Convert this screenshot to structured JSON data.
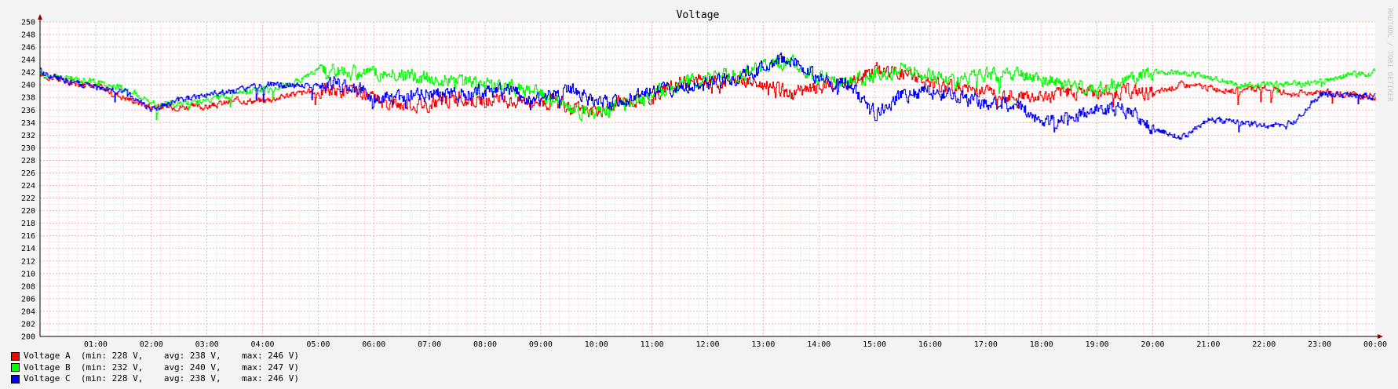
{
  "colors": {
    "background": "#f3f3f3",
    "plot_background": "#ffffff",
    "grid_minor": "#f1c6c6",
    "grid_major": "#e8a7a7",
    "axis": "#880000"
  },
  "side_label": "RRDTOOL / TOBI OETIKER",
  "legend": [
    {
      "name": "Voltage A",
      "color": "#ff0000",
      "stats": "  (min: 228 V,    avg: 238 V,    max: 246 V)"
    },
    {
      "name": "Voltage B",
      "color": "#00ff00",
      "stats": "  (min: 232 V,    avg: 240 V,    max: 247 V)"
    },
    {
      "name": "Voltage C",
      "color": "#0000ff",
      "stats": "  (min: 228 V,    avg: 238 V,    max: 246 V)"
    }
  ],
  "chart_data": {
    "type": "line",
    "title": "Voltage",
    "xlabel": "",
    "ylabel": "",
    "ylim": [
      200,
      250
    ],
    "y_ticks": [
      200,
      202,
      204,
      206,
      208,
      210,
      212,
      214,
      216,
      218,
      220,
      222,
      224,
      226,
      228,
      230,
      232,
      234,
      236,
      238,
      240,
      242,
      244,
      246,
      248,
      250
    ],
    "x_ticks": [
      "01:00",
      "02:00",
      "03:00",
      "04:00",
      "05:00",
      "06:00",
      "07:00",
      "08:00",
      "09:00",
      "10:00",
      "11:00",
      "12:00",
      "13:00",
      "14:00",
      "15:00",
      "16:00",
      "17:00",
      "18:00",
      "19:00",
      "20:00",
      "21:00",
      "22:00",
      "23:00",
      "00:00"
    ],
    "x_hours": [
      0,
      0.5,
      1,
      1.5,
      2,
      2.5,
      3,
      3.5,
      4,
      4.5,
      5,
      5.5,
      6,
      6.5,
      7,
      7.5,
      8,
      8.5,
      9,
      9.5,
      10,
      10.5,
      11,
      11.5,
      12,
      12.5,
      13,
      13.5,
      14,
      14.5,
      15,
      15.5,
      16,
      16.5,
      17,
      17.5,
      18,
      18.5,
      19,
      19.5,
      20,
      20.5,
      21,
      21.5,
      22,
      22.5,
      23,
      23.5,
      24
    ],
    "grid": true,
    "series": [
      {
        "name": "Voltage A",
        "color": "#ff0000",
        "values": [
          241.5,
          240.5,
          239.8,
          238,
          236.5,
          236.5,
          236.5,
          237.5,
          237.5,
          238.5,
          239,
          239,
          237.5,
          237,
          237,
          238,
          237.5,
          237.5,
          237.5,
          236.5,
          235.5,
          237.5,
          238,
          240.5,
          240.5,
          241,
          240,
          238.5,
          239.5,
          240,
          242.5,
          242,
          240,
          239.5,
          239,
          238.5,
          238,
          239,
          239,
          239,
          238.5,
          240,
          239.5,
          239,
          239.5,
          238.5,
          239,
          238.5,
          238
        ]
      },
      {
        "name": "Voltage B",
        "color": "#00ff00",
        "values": [
          241.5,
          241,
          240.5,
          239.5,
          237,
          237,
          237.5,
          238.5,
          239.5,
          240,
          242.5,
          242,
          242,
          241.5,
          241,
          240.5,
          240,
          239.5,
          238.5,
          236,
          235.5,
          237,
          238.5,
          240,
          241.5,
          241.5,
          243,
          243.5,
          241,
          240.5,
          241.5,
          242.5,
          241.5,
          240.5,
          241.5,
          241.5,
          241,
          240,
          239.5,
          240.5,
          242,
          242,
          241,
          240,
          240,
          240,
          240.5,
          241.5,
          242
        ]
      },
      {
        "name": "Voltage C",
        "color": "#0000ff",
        "values": [
          242,
          240.5,
          239.5,
          239,
          236,
          237.5,
          238.5,
          239,
          240,
          240,
          240,
          240,
          238,
          238,
          238.5,
          238.5,
          239,
          239,
          237.5,
          239.5,
          237,
          237.5,
          239,
          239.5,
          240,
          241,
          242.5,
          244.5,
          240.5,
          240,
          235.5,
          238.5,
          239,
          238,
          237,
          237,
          234,
          235,
          236,
          236,
          233,
          231.5,
          234.5,
          234,
          233.5,
          234,
          238.5,
          238.5,
          238
        ]
      }
    ]
  }
}
